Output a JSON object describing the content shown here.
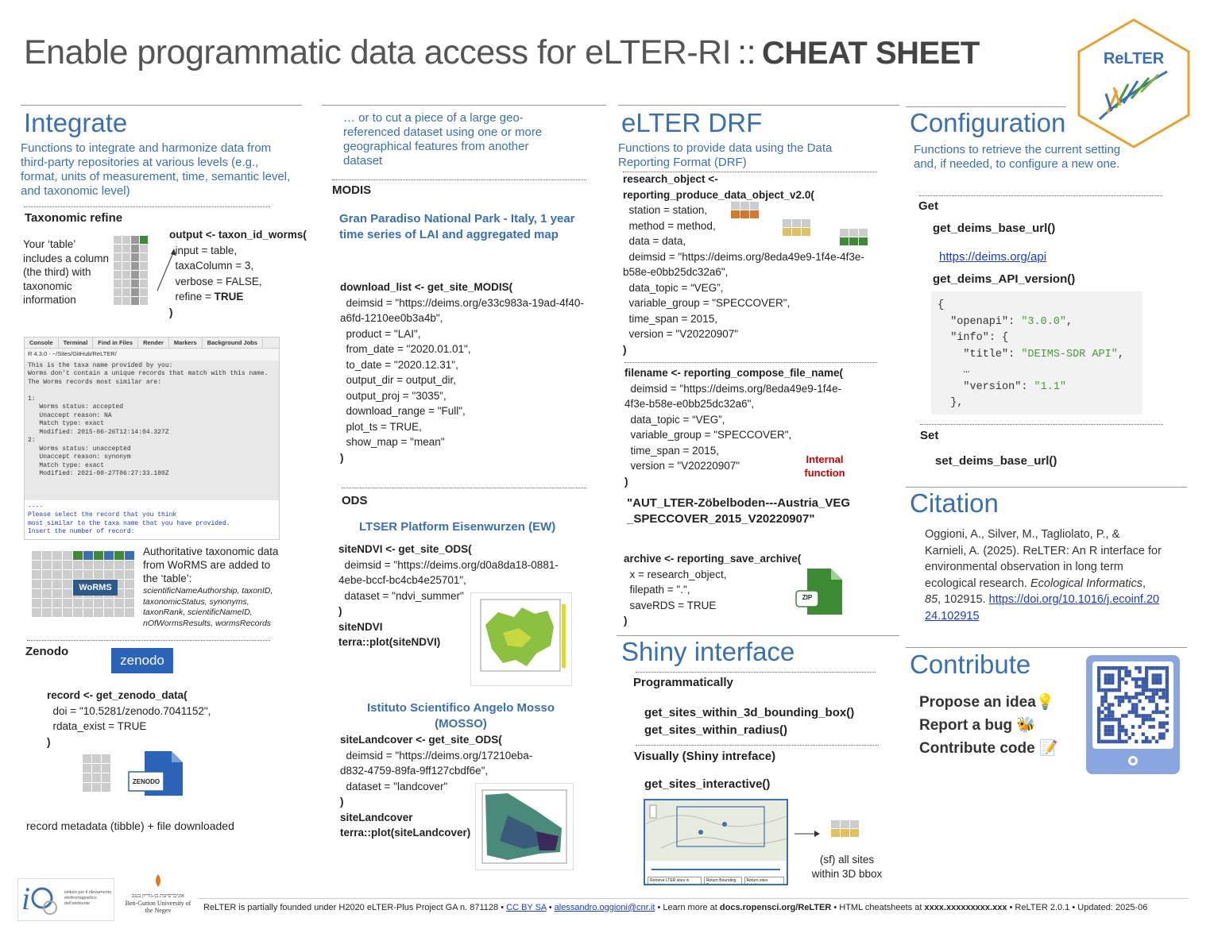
{
  "header": {
    "title": "Enable programmatic data access for eLTER-RI",
    "sep": "::",
    "cheat": "CHEAT SHEET",
    "logo_text": "ReLTER"
  },
  "integrate": {
    "title": "Integrate",
    "desc": "Functions to integrate and harmonize data from third-party repositories at various levels (e.g., format, units of measurement, time, semantic level, and taxonomic level)",
    "taxo_title": "Taxonomic refine",
    "taxo_text": "Your ‘table’ includes a column (the third) with taxonomic information",
    "taxo_code": [
      "output <- taxon_id_worms(",
      "  input = table,",
      "  taxaColumn = 3,",
      "  verbose = FALSE,",
      "  refine = TRUE",
      ")"
    ],
    "console_tabs": [
      "Console",
      "Terminal",
      "Find in Files",
      "Render",
      "Markers",
      "Background Jobs"
    ],
    "console_path": "R 4.3.0 · ~/Sites/GitHub/ReLTER/",
    "console_lines": [
      "This is the taxa name provided by you:",
      "Worms don't contain a unique records that match with this name.",
      "The Worms records most similar are:",
      "",
      "1:",
      "   Worms status: accepted",
      "   Unaccept reason: NA",
      "   Match type: exact",
      "   Modified: 2015-06-26T12:14:04.327Z",
      "2:",
      "   Worms status: unaccepted",
      "   Unaccept reason: synonym",
      "   Match type: exact",
      "   Modified: 2021-08-27T06:27:33.180Z"
    ],
    "console_prompt": [
      "----",
      "Please select the record that you think",
      "most similar to the taxa name that you have provided.",
      "Insert the number of record:"
    ],
    "worms_text": "Authoritative taxonomic data from WoRMS are added to the ‘table’:",
    "worms_fields": "scientificNameAuthorship, taxonID, taxonomicStatus, synonyms, taxonRank, scientificNameID, nOfWormsResults, wormsRecords",
    "worms_logo": "WoRMS",
    "zenodo_title": "Zenodo",
    "zenodo_logo": "zenodo",
    "zenodo_code": [
      "record <- get_zenodo_data(",
      "  doi = \"10.5281/zenodo.7041152\",",
      "  rdata_exist = TRUE",
      ")"
    ],
    "zenodo_file": "ZENODO",
    "zenodo_result": "record metadata (tibble) + file downloaded"
  },
  "geo": {
    "desc": "… or to cut a piece of a large geo-referenced dataset using one or more geographical features from another dataset",
    "modis_title": "MODIS",
    "modis_head": "Gran Paradiso National Park - Italy, 1 year time series of LAI and aggregated map",
    "modis_code": [
      "download_list <- get_site_MODIS(",
      "  deimsid = \"https://deims.org/e33c983a-19ad-4f40-",
      "a6fd-1210ee0b3a4b\",",
      "  product = \"LAI\",",
      "  from_date = \"2020.01.01\",",
      "  to_date = \"2020.12.31\",",
      "  output_dir = output_dir,",
      "  output_proj = \"3035\",",
      "  download_range = \"Full\",",
      "  plot_ts = TRUE,",
      "  show_map = \"mean\"",
      ")"
    ],
    "ods_title": "ODS",
    "ods_head1": "LTSER Platform Eisenwurzen (EW)",
    "ods_code1": [
      "siteNDVI <- get_site_ODS(",
      "  deimsid = \"https://deims.org/d0a8da18-0881-",
      "4ebe-bccf-bc4cb4e25701\",",
      "  dataset = \"ndvi_summer\"",
      ")",
      "siteNDVI",
      "terra::plot(siteNDVI)"
    ],
    "ods_head2": "Istituto Scientifico Angelo Mosso (MOSSO)",
    "ods_code2": [
      "siteLandcover <- get_site_ODS(",
      "  deimsid = \"https://deims.org/17210eba-",
      "d832-4759-89fa-9ff127cbdf6e\",",
      "  dataset = \"landcover\"",
      ")",
      "siteLandcover",
      "terra::plot(siteLandcover)"
    ]
  },
  "drf": {
    "title": "eLTER DRF",
    "desc": "Functions to provide data using the Data Reporting Format (DRF)",
    "code1": [
      "research_object <-",
      "reporting_produce_data_object_v2.0(",
      "  station = station,",
      "  method = method,",
      "  data = data,",
      "  deimsid = \"https://deims.org/8eda49e9-1f4e-4f3e-",
      "b58e-e0bb25dc32a6\",",
      "  data_topic = “VEG”,",
      "  variable_group = \"SPECCOVER\",",
      "  time_span = 2015,",
      "  version = \"V20220907\"",
      ")"
    ],
    "code2": [
      "filename <- reporting_compose_file_name(",
      "  deimsid = \"https://deims.org/8eda49e9-1f4e-",
      "4f3e-b58e-e0bb25dc32a6\",",
      "  data_topic = “VEG”,",
      "  variable_group = \"SPECCOVER\",",
      "  time_span = 2015,",
      "  version = \"V20220907\"",
      ")"
    ],
    "internal": "Internal function",
    "filename_result": "\"AUT_LTER-Zöbelboden---Austria_VEG_SPECCOVER_2015_V20220907\"",
    "code3": [
      "archive <- reporting_save_archive(",
      "  x = research_object,",
      "  filepath = \".\",",
      "  saveRDS = TRUE",
      ")"
    ],
    "zip": "ZIP"
  },
  "shiny": {
    "title": "Shiny interface",
    "prog_title": "Programmatically",
    "prog_fns": [
      "get_sites_within_3d_bounding_box()",
      "get_sites_within_radius()"
    ],
    "vis_title": "Visually (Shiny intreface)",
    "vis_fn": "get_sites_interactive()",
    "buttons": [
      "Retrieve LTER sites in selection",
      "Return Bounding Box",
      "Return sites dataframe"
    ],
    "result": "(sf) all sites within 3D bbox"
  },
  "config": {
    "title": "Configuration",
    "desc": "Functions to retrieve the current setting and, if needed, to configure a new one.",
    "get_title": "Get",
    "fn1": "get_deims_base_url()",
    "url": "https://deims.org/api",
    "fn2": "get_deims_API_version()",
    "json": {
      "openapi_key": "\"openapi\"",
      "openapi_val": "\"3.0.0\"",
      "info_key": "\"info\"",
      "title_key": "\"title\"",
      "title_val": "\"DEIMS-SDR API\"",
      "ellipsis": "…",
      "version_key": "\"version\"",
      "version_val": "\"1.1\""
    },
    "set_title": "Set",
    "fn3": "set_deims_base_url()"
  },
  "citation": {
    "title": "Citation",
    "text": "Oggioni, A., Silver, M., Tagliolato, P., & Karnieli, A. (2025). ReLTER: An R interface for environmental observation in long term ecological research.",
    "journal": "Ecological Informatics",
    "vol": "85",
    "pages": ", 102915.",
    "doi": "https://doi.org/10.1016/j.ecoinf.2024.102915"
  },
  "contribute": {
    "title": "Contribute",
    "items": [
      "Propose an idea💡",
      "Report a bug 🐝",
      "Contribute code 📝"
    ]
  },
  "footer": {
    "text1": "ReLTER is partially founded under H2020 eLTER-Plus Project GA n. 871128  •  ",
    "license": "CC BY SA",
    "bullet": "  •  ",
    "email": "alessandro.oggioni@cnr.it",
    "text2": "  •  Learn more at ",
    "docs": "docs.ropensci.org/ReLTER",
    "text3": "  •  HTML cheatsheets at ",
    "html": "xxxx.xxxxxxxxx.xxx",
    "text4": "  •  ReLTER 2.0.1  •  Updated: 2025-06",
    "logo1": "istituto per il rilevamento elettromagnetico dell'ambiente",
    "logo2": "Ben-Gurion University of the Negev",
    "logo2_he": "אוניברסיטת בן-גוריון בנגב"
  },
  "colors": {
    "accent": "#3a6fb0",
    "internal": "#cc0000",
    "green": "#3d8a35",
    "orange": "#d4792a",
    "yellow": "#e0c060"
  }
}
